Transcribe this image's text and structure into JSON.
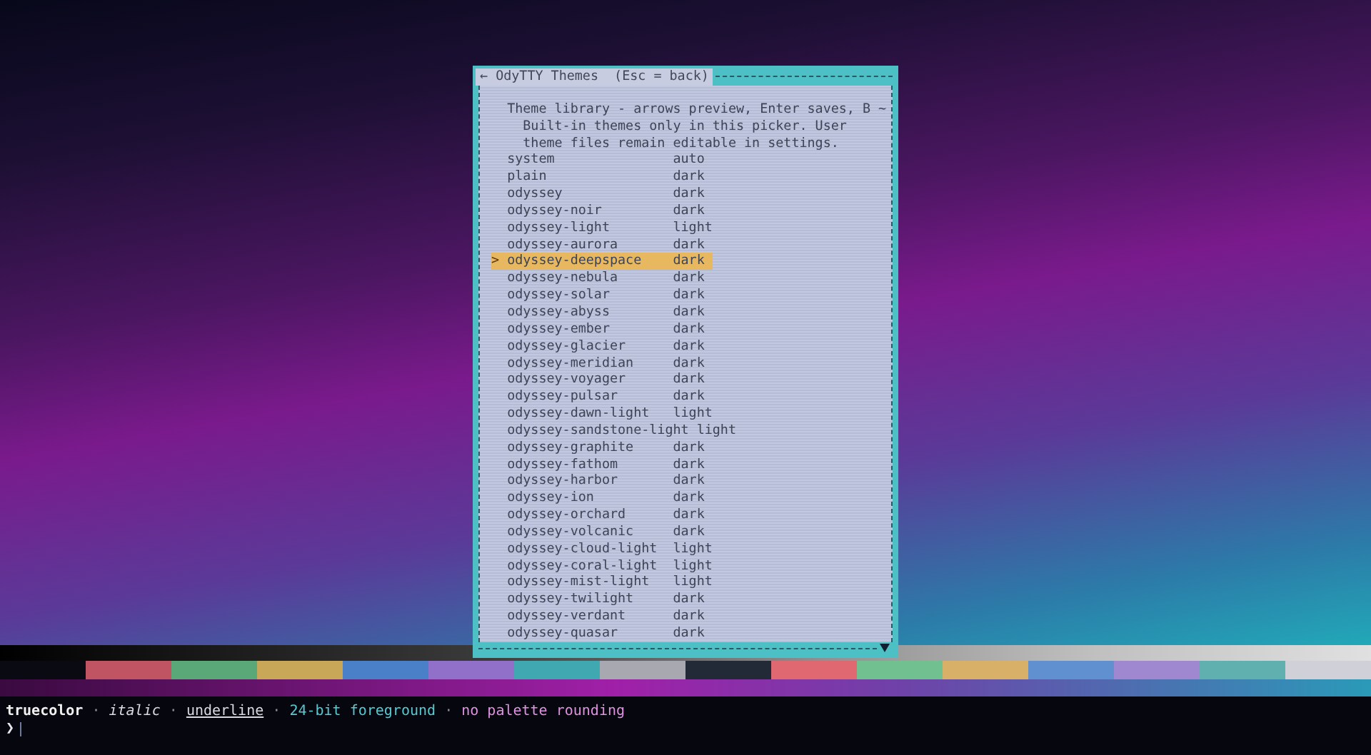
{
  "dialog": {
    "title": "← OdyTTY Themes  (Esc = back)",
    "cursor_marker": ">",
    "description_lines": [
      "Theme library - arrows preview, Enter saves, B ~",
      "Built-in themes only in this picker. User",
      "theme files remain editable in settings."
    ],
    "themes": [
      {
        "name": "system",
        "mode": "auto",
        "selected": false
      },
      {
        "name": "plain",
        "mode": "dark",
        "selected": false
      },
      {
        "name": "odyssey",
        "mode": "dark",
        "selected": false
      },
      {
        "name": "odyssey-noir",
        "mode": "dark",
        "selected": false
      },
      {
        "name": "odyssey-light",
        "mode": "light",
        "selected": false
      },
      {
        "name": "odyssey-aurora",
        "mode": "dark",
        "selected": false
      },
      {
        "name": "odyssey-deepspace",
        "mode": "dark",
        "selected": true
      },
      {
        "name": "odyssey-nebula",
        "mode": "dark",
        "selected": false
      },
      {
        "name": "odyssey-solar",
        "mode": "dark",
        "selected": false
      },
      {
        "name": "odyssey-abyss",
        "mode": "dark",
        "selected": false
      },
      {
        "name": "odyssey-ember",
        "mode": "dark",
        "selected": false
      },
      {
        "name": "odyssey-glacier",
        "mode": "dark",
        "selected": false
      },
      {
        "name": "odyssey-meridian",
        "mode": "dark",
        "selected": false
      },
      {
        "name": "odyssey-voyager",
        "mode": "dark",
        "selected": false
      },
      {
        "name": "odyssey-pulsar",
        "mode": "dark",
        "selected": false
      },
      {
        "name": "odyssey-dawn-light",
        "mode": "light",
        "selected": false
      },
      {
        "name": "odyssey-sandstone-light",
        "mode": "light",
        "selected": false
      },
      {
        "name": "odyssey-graphite",
        "mode": "dark",
        "selected": false
      },
      {
        "name": "odyssey-fathom",
        "mode": "dark",
        "selected": false
      },
      {
        "name": "odyssey-harbor",
        "mode": "dark",
        "selected": false
      },
      {
        "name": "odyssey-ion",
        "mode": "dark",
        "selected": false
      },
      {
        "name": "odyssey-orchard",
        "mode": "dark",
        "selected": false
      },
      {
        "name": "odyssey-volcanic",
        "mode": "dark",
        "selected": false
      },
      {
        "name": "odyssey-cloud-light",
        "mode": "light",
        "selected": false
      },
      {
        "name": "odyssey-coral-light",
        "mode": "light",
        "selected": false
      },
      {
        "name": "odyssey-mist-light",
        "mode": "light",
        "selected": false
      },
      {
        "name": "odyssey-twilight",
        "mode": "dark",
        "selected": false
      },
      {
        "name": "odyssey-verdant",
        "mode": "dark",
        "selected": false
      },
      {
        "name": "odyssey-quasar",
        "mode": "dark",
        "selected": false
      }
    ]
  },
  "palette": [
    {
      "color": "#c05462"
    },
    {
      "color": "#5aa878"
    },
    {
      "color": "#c8a858"
    },
    {
      "color": "#4a80c8"
    },
    {
      "color": "#9070c8"
    },
    {
      "color": "#40a8b0"
    },
    {
      "color": "#a8a8b0"
    },
    {
      "color": "#222a38"
    },
    {
      "color": "#e06870"
    },
    {
      "color": "#70c090"
    },
    {
      "color": "#d8b068"
    },
    {
      "color": "#6090d0"
    },
    {
      "color": "#a088d0"
    },
    {
      "color": "#60b0b0"
    },
    {
      "color": "#d0d0d8"
    }
  ],
  "status_line": [
    {
      "text": "truecolor",
      "kind": "bold"
    },
    {
      "text": "·",
      "kind": "separator"
    },
    {
      "text": "italic",
      "kind": "italic"
    },
    {
      "text": "·",
      "kind": "separator"
    },
    {
      "text": "underline",
      "kind": "underline"
    },
    {
      "text": "·",
      "kind": "separator"
    },
    {
      "text": "24-bit foreground",
      "kind": "teal"
    },
    {
      "text": "·",
      "kind": "separator"
    },
    {
      "text": "no palette rounding",
      "kind": "pink"
    }
  ],
  "prompt": "❯"
}
